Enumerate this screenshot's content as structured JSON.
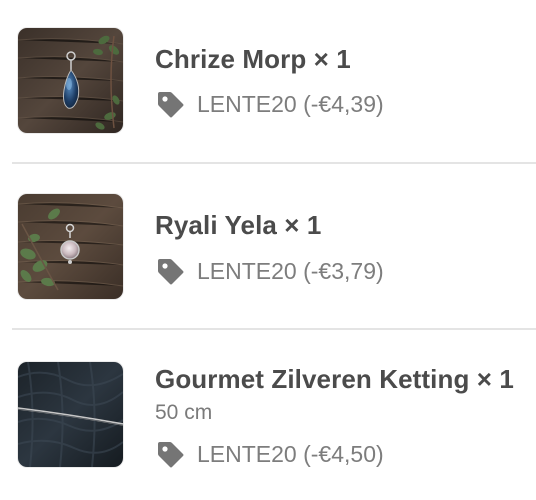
{
  "items": [
    {
      "title": "Chrize Morp × 1",
      "discount": "LENTE20 (-€4,39)",
      "thumbnail_icon": "blue-gemstone-pendant-image"
    },
    {
      "title": "Ryali Yela × 1",
      "discount": "LENTE20 (-€3,79)",
      "thumbnail_icon": "silver-crystal-pendant-image"
    },
    {
      "title": "Gourmet Zilveren Ketting × 1",
      "variant": "50 cm",
      "discount": "LENTE20 (-€4,50)",
      "thumbnail_icon": "silver-chain-necklace-image"
    }
  ],
  "discount_icon": "discount-tag-icon",
  "colors": {
    "text": "#4b4b4b",
    "muted": "#7d7d7d",
    "divider": "#e4e4e4",
    "tag": "#757575"
  }
}
